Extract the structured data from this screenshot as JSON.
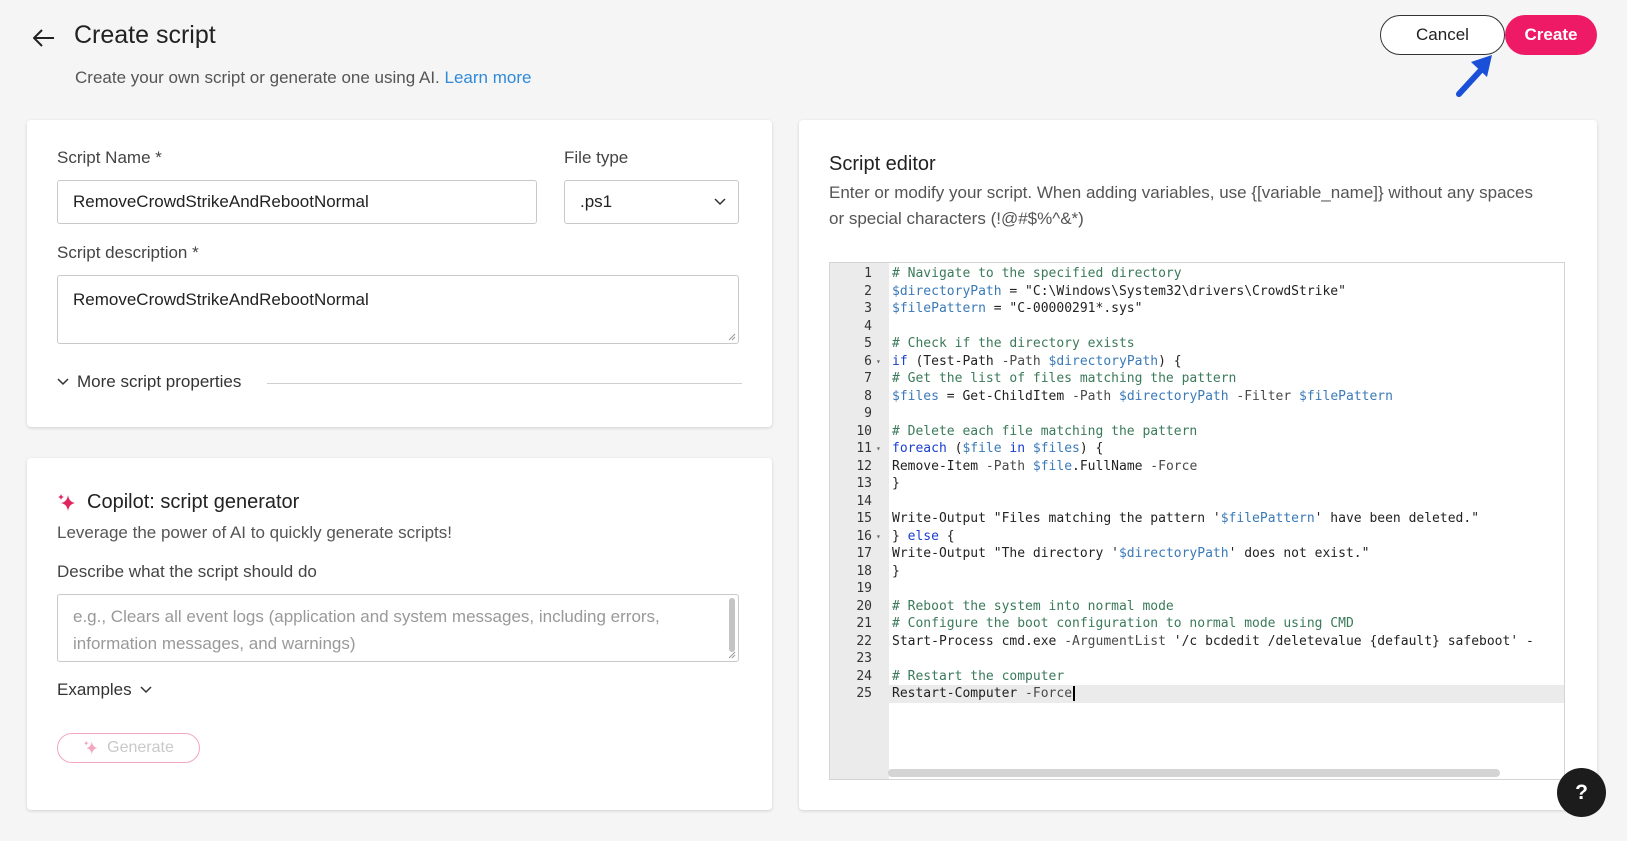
{
  "header": {
    "title": "Create script",
    "subtitle": "Create your own script or generate one using AI.",
    "learn_more": "Learn more",
    "cancel_label": "Cancel",
    "create_label": "Create"
  },
  "colors": {
    "accent": "#ef1a66",
    "link": "#2f8ad9",
    "annotation_arrow": "#1a4fd8"
  },
  "properties": {
    "script_name_label": "Script Name *",
    "script_name_value": "RemoveCrowdStrikeAndRebootNormal",
    "file_type_label": "File type",
    "file_type_value": ".ps1",
    "description_label": "Script description *",
    "description_value": "RemoveCrowdStrikeAndRebootNormal",
    "more_properties": "More script properties"
  },
  "copilot": {
    "title": "Copilot: script generator",
    "subtitle": "Leverage the power of AI to quickly generate scripts!",
    "prompt_label": "Describe what the script should do",
    "prompt_placeholder": "e.g., Clears all event logs (application and system messages, including errors, information messages, and warnings)",
    "examples_label": "Examples",
    "generate_label": "Generate"
  },
  "editor": {
    "title": "Script editor",
    "description": "Enter or modify your script. When adding variables, use {[variable_name]} without any spaces or special characters (!@#$%^&*)",
    "lines": [
      "# Navigate to the specified directory",
      "$directoryPath = \"C:\\Windows\\System32\\drivers\\CrowdStrike\"",
      "$filePattern = \"C-00000291*.sys\"",
      "",
      "# Check if the directory exists",
      "if (Test-Path -Path $directoryPath) {",
      "# Get the list of files matching the pattern",
      "$files = Get-ChildItem -Path $directoryPath -Filter $filePattern",
      "",
      "# Delete each file matching the pattern",
      "foreach ($file in $files) {",
      "Remove-Item -Path $file.FullName -Force",
      "}",
      "",
      "Write-Output \"Files matching the pattern '$filePattern' have been deleted.\"",
      "} else {",
      "Write-Output \"The directory '$directoryPath' does not exist.\"",
      "}",
      "",
      "# Reboot the system into normal mode",
      "# Configure the boot configuration to normal mode using CMD",
      "Start-Process cmd.exe -ArgumentList '/c bcdedit /deletevalue {default} safeboot' -",
      "",
      "# Restart the computer",
      "Restart-Computer -Force"
    ],
    "foldable_lines": [
      6,
      11,
      16
    ],
    "active_line": 25
  },
  "help_label": "?"
}
